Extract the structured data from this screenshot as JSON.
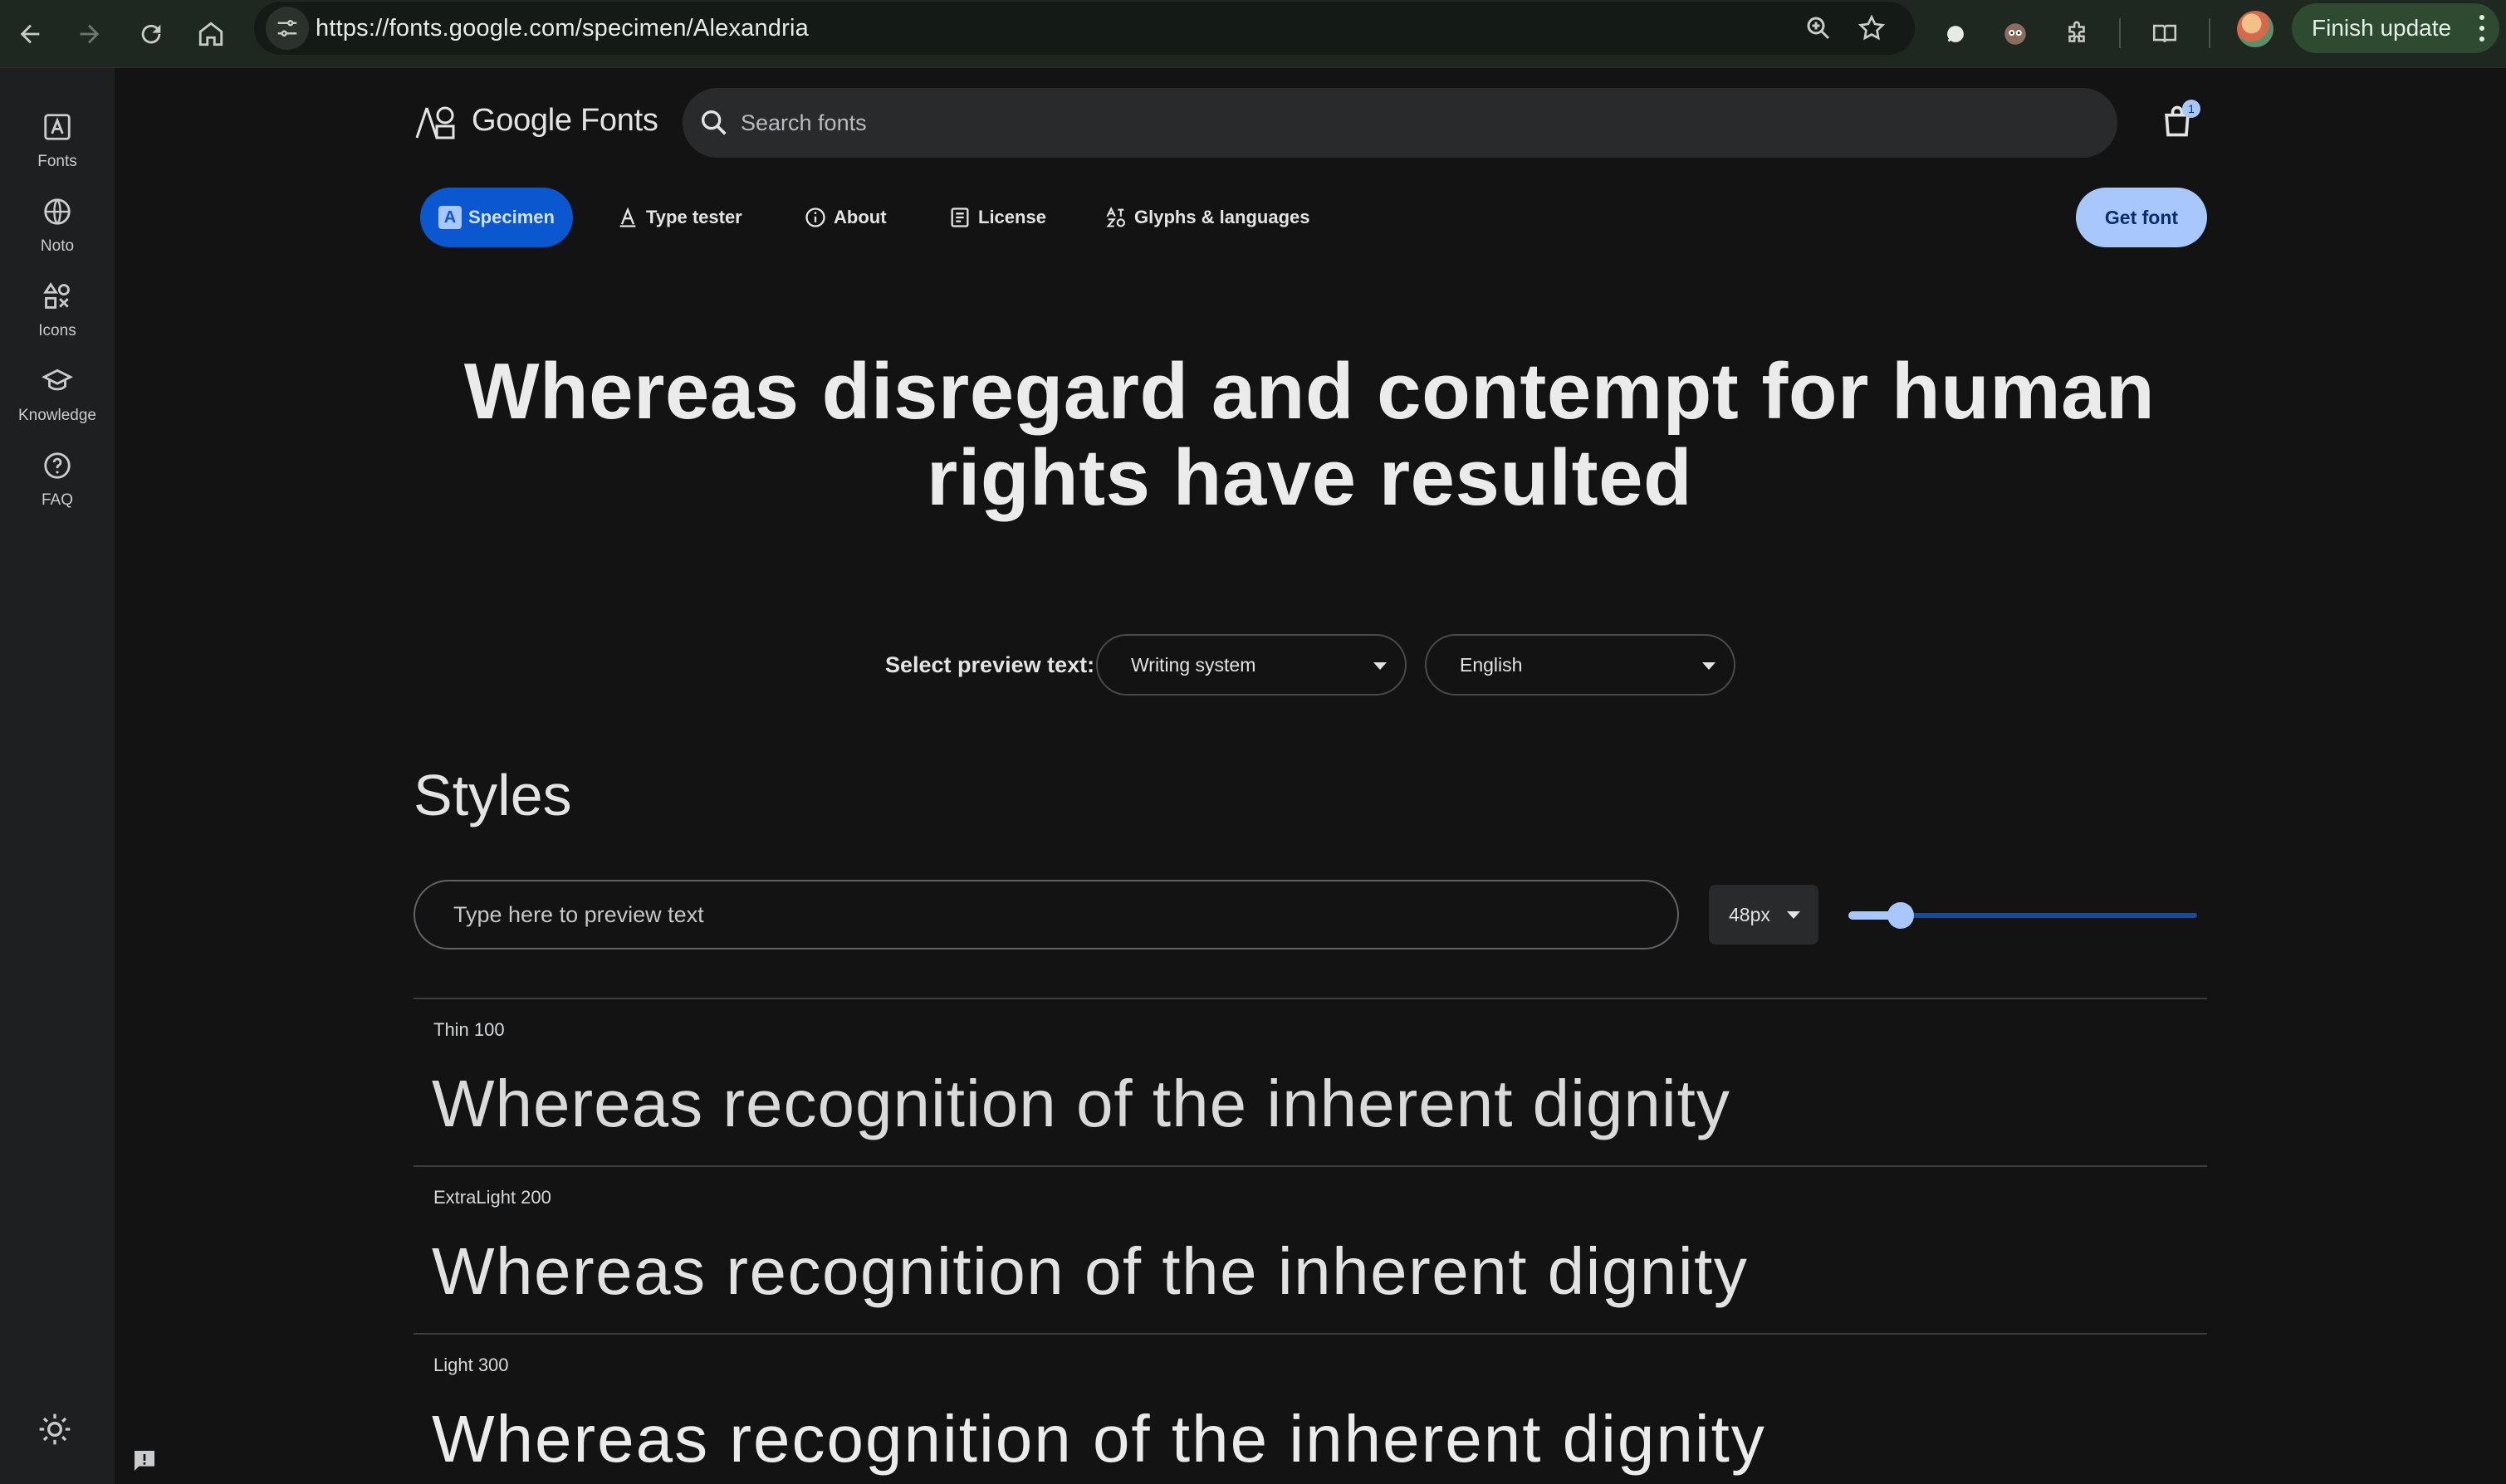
{
  "browser": {
    "url": "https://fonts.google.com/specimen/Alexandria",
    "finish_update_label": "Finish update"
  },
  "rail": {
    "items": [
      {
        "label": "Fonts",
        "icon": "fonts-icon"
      },
      {
        "label": "Noto",
        "icon": "globe-icon"
      },
      {
        "label": "Icons",
        "icon": "shapes-icon"
      },
      {
        "label": "Knowledge",
        "icon": "graduation-cap-icon"
      },
      {
        "label": "FAQ",
        "icon": "help-circle-icon"
      }
    ]
  },
  "header": {
    "logo_text": "Google Fonts",
    "search_placeholder": "Search fonts",
    "bag_count": "1"
  },
  "tabs": [
    {
      "label": "Specimen",
      "icon": "specimen-icon",
      "active": true
    },
    {
      "label": "Type tester",
      "icon": "type-tester-icon"
    },
    {
      "label": "About",
      "icon": "info-icon"
    },
    {
      "label": "License",
      "icon": "license-icon"
    },
    {
      "label": "Glyphs & languages",
      "icon": "glyphs-icon"
    }
  ],
  "get_font_label": "Get font",
  "hero": {
    "line1": "Whereas disregard and contempt for human",
    "line2": "rights have resulted"
  },
  "preview": {
    "label": "Select preview text:",
    "writing_system": "Writing system",
    "language": "English"
  },
  "styles": {
    "title": "Styles",
    "input_placeholder": "Type here to preview text",
    "size_value": "48px",
    "size_slider_fraction": 0.15,
    "rows": [
      {
        "name": "Thin 100",
        "sample": "Whereas recognition of the inherent dignity",
        "weight": 100
      },
      {
        "name": "ExtraLight 200",
        "sample": "Whereas recognition of the inherent dignity",
        "weight": 200
      },
      {
        "name": "Light 300",
        "sample": "Whereas recognition of the inherent dignity",
        "weight": 300
      }
    ]
  },
  "colors": {
    "accent": "#a8c7fa",
    "active_tab": "#0b57d0",
    "background": "#131314",
    "rail": "#1e1f20"
  }
}
